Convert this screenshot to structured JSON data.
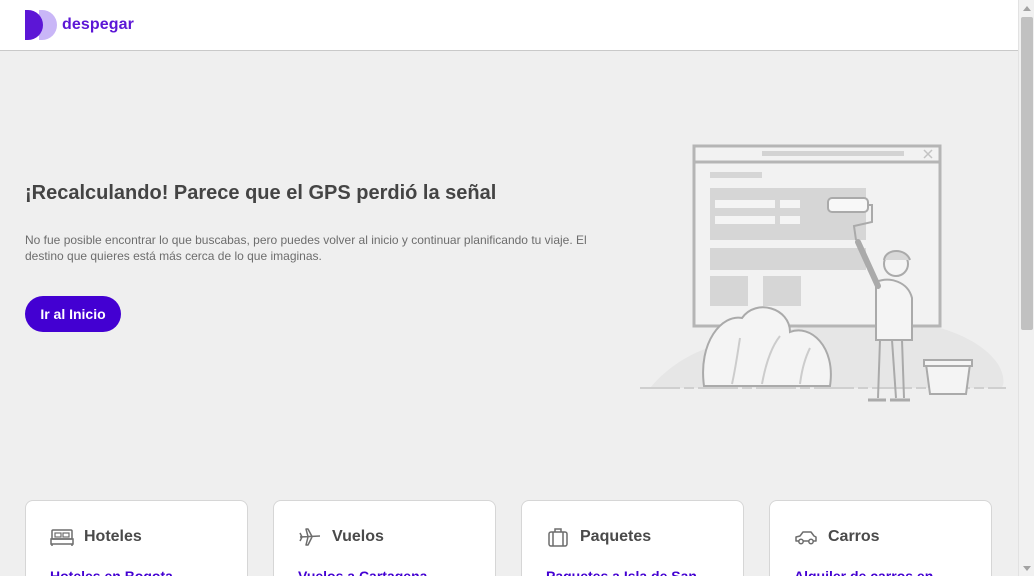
{
  "header": {
    "logo_text": "despegar",
    "brand_color": "#5c16d6"
  },
  "hero": {
    "title": "¡Recalculando! Parece que el GPS perdió la señal",
    "description": "No fue posible encontrar lo que buscabas, pero puedes volver al inicio y continuar planificando tu viaje. El destino que quieres está más cerca de lo que imaginas.",
    "button_label": "Ir al Inicio",
    "button_color": "#4300d2"
  },
  "cards": [
    {
      "icon": "bed-icon",
      "title": "Hoteles",
      "link": "Hoteles en Bogota"
    },
    {
      "icon": "plane-icon",
      "title": "Vuelos",
      "link": "Vuelos a Cartagena"
    },
    {
      "icon": "suitcase-icon",
      "title": "Paquetes",
      "link": "Paquetes a Isla de San"
    },
    {
      "icon": "car-icon",
      "title": "Carros",
      "link": "Alquiler de carros en"
    }
  ]
}
